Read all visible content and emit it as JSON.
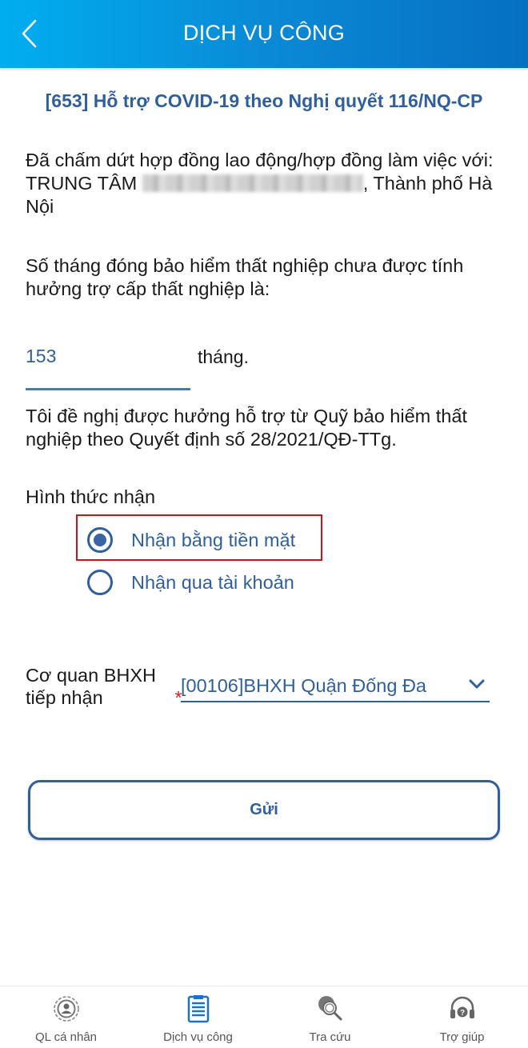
{
  "header": {
    "title": "DỊCH VỤ CÔNG",
    "back_icon": "chevron-left-icon"
  },
  "service": {
    "title": "[653] Hỗ trợ COVID-19 theo Nghị quyết 116/NQ-CP"
  },
  "contract": {
    "text_before": "Đã chấm dứt hợp đồng  lao động/hợp đồng làm việc với: TRUNG TÂM ",
    "redacted_label": "redacted-company-name",
    "text_after": ", Thành phố Hà Nội"
  },
  "months": {
    "question": "Số tháng đóng bảo hiểm thất nghiệp chưa được tính hưởng trợ cấp thất nghiệp là:",
    "value": "153",
    "unit": "tháng."
  },
  "request": {
    "text": "Tôi đề nghị được hưởng hỗ trợ từ Quỹ bảo hiểm thất nghiệp theo Quyết định số 28/2021/QĐ-TTg."
  },
  "receive_method": {
    "label": "Hình thức nhận",
    "options": [
      {
        "label": "Nhận bằng tiền mặt",
        "checked": true
      },
      {
        "label": "Nhận qua tài khoản",
        "checked": false
      }
    ]
  },
  "agency": {
    "label": "Cơ quan BHXH tiếp nhận",
    "required_mark": "*",
    "selected": "[00106]BHXH Quận Đống Đa"
  },
  "submit": {
    "label": "Gửi"
  },
  "bottom_nav": [
    {
      "label": "QL cá nhân",
      "icon": "user-gear-icon",
      "active": false
    },
    {
      "label": "Dịch vụ công",
      "icon": "clipboard-icon",
      "active": true
    },
    {
      "label": "Tra cứu",
      "icon": "globe-search-icon",
      "active": false
    },
    {
      "label": "Trợ giúp",
      "icon": "headset-help-icon",
      "active": false
    }
  ],
  "colors": {
    "header_start": "#00aeef",
    "header_end": "#0670c0",
    "primary_text": "#2f5f9c",
    "highlight": "#d0111b",
    "active_icon": "#1a73c8"
  }
}
